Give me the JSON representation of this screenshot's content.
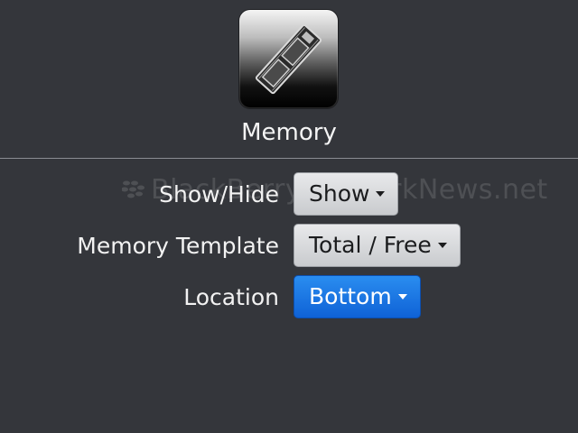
{
  "app": {
    "icon": "memory-chip-icon",
    "title": "Memory"
  },
  "watermark": {
    "text": "BlackBerryNetworkNews.net"
  },
  "settings": [
    {
      "label": "Show/Hide",
      "value": "Show"
    },
    {
      "label": "Memory Template",
      "value": "Total / Free"
    },
    {
      "label": "Location",
      "value": "Bottom",
      "focused": true
    }
  ],
  "colors": {
    "background": "#34363b",
    "focus_accent": "#1a73e0",
    "dropdown_grey": "#d8d9db"
  }
}
